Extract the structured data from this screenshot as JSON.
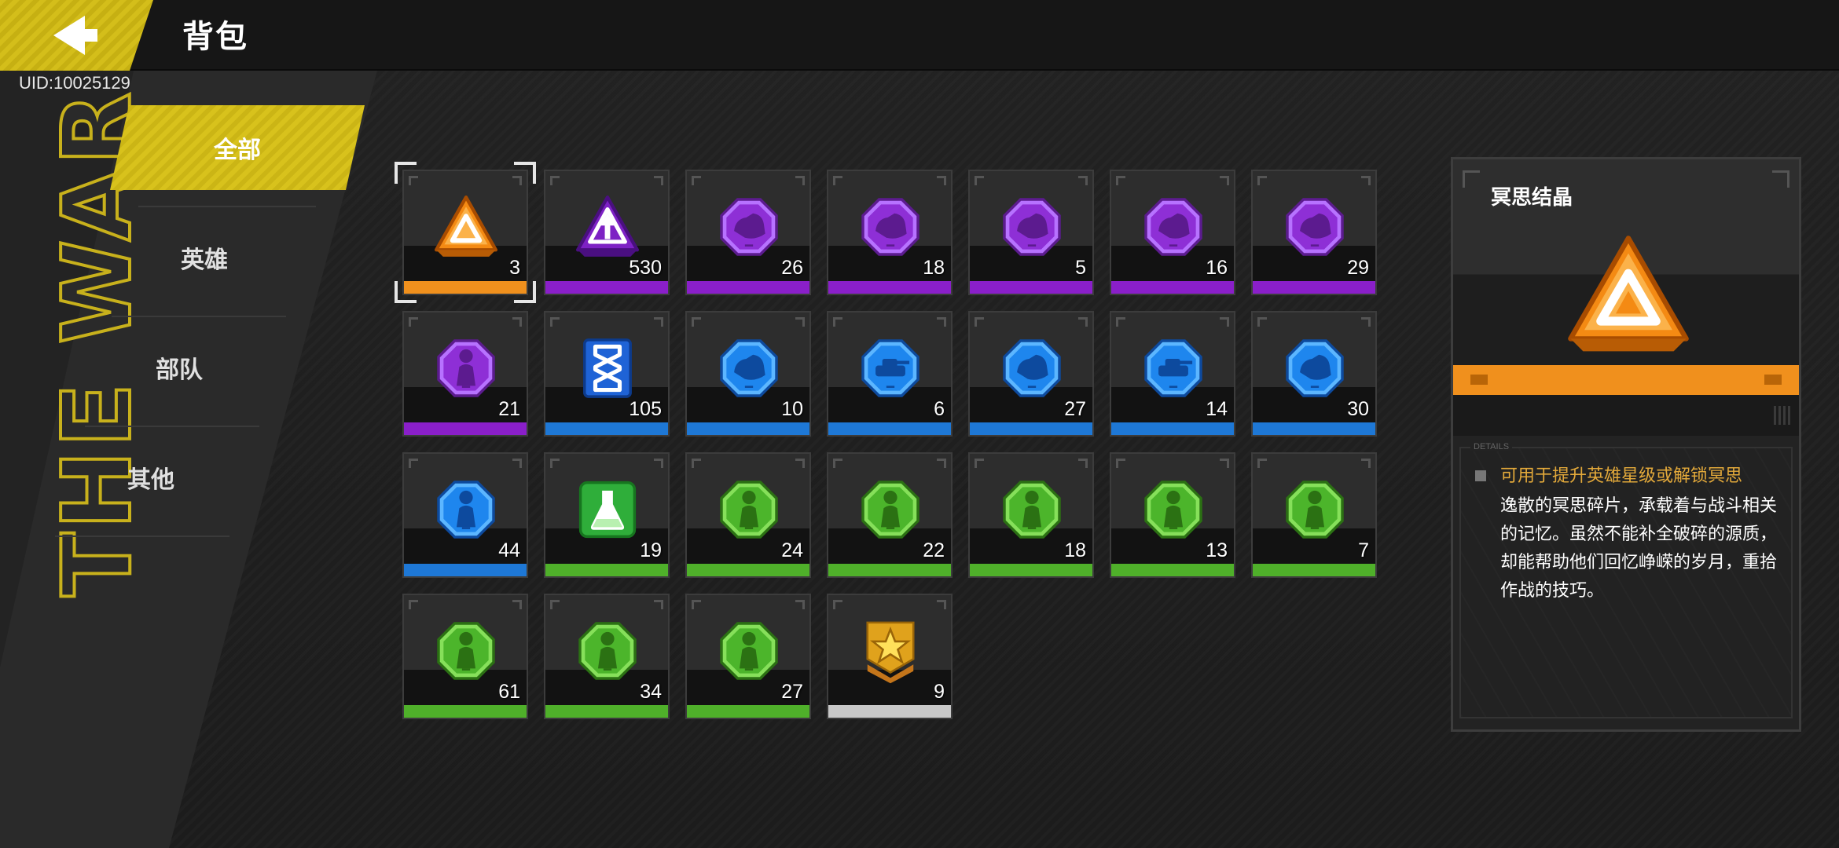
{
  "header": {
    "title": "背包",
    "uid": "UID:10025129",
    "back_icon": "back-arrow-icon"
  },
  "background_text": "THE WAR",
  "colors": {
    "accent_yellow": "#d8c21c",
    "rarity_orange": "#f0901d",
    "rarity_purple": "#8a1fc9",
    "rarity_blue": "#1e78d6",
    "rarity_green": "#4fb02a",
    "rarity_white": "#c8c8c8",
    "description_highlight": "#e3a93a"
  },
  "categories": [
    {
      "label": "全部",
      "active": true
    },
    {
      "label": "英雄",
      "active": false
    },
    {
      "label": "部队",
      "active": false
    },
    {
      "label": "其他",
      "active": false
    }
  ],
  "items": [
    {
      "count": "3",
      "rarity": "orange",
      "icon": "orange-triangle-crystal-icon",
      "selected": true
    },
    {
      "count": "530",
      "rarity": "purple",
      "icon": "purple-triangle-upgrade-icon"
    },
    {
      "count": "26",
      "rarity": "purple",
      "icon": "purple-unit-badge-icon"
    },
    {
      "count": "18",
      "rarity": "purple",
      "icon": "purple-unit-badge-icon"
    },
    {
      "count": "5",
      "rarity": "purple",
      "icon": "purple-unit-badge-icon"
    },
    {
      "count": "16",
      "rarity": "purple",
      "icon": "purple-unit-badge-icon"
    },
    {
      "count": "29",
      "rarity": "purple",
      "icon": "purple-unit-badge-icon"
    },
    {
      "count": "21",
      "rarity": "purple",
      "icon": "purple-hero-badge-icon"
    },
    {
      "count": "105",
      "rarity": "blue",
      "icon": "blue-dna-helix-icon"
    },
    {
      "count": "10",
      "rarity": "blue",
      "icon": "blue-unit-badge-icon"
    },
    {
      "count": "6",
      "rarity": "blue",
      "icon": "blue-tank-badge-icon"
    },
    {
      "count": "27",
      "rarity": "blue",
      "icon": "blue-unit-badge-icon"
    },
    {
      "count": "14",
      "rarity": "blue",
      "icon": "blue-tank-badge-icon"
    },
    {
      "count": "30",
      "rarity": "blue",
      "icon": "blue-unit-badge-icon"
    },
    {
      "count": "44",
      "rarity": "blue",
      "icon": "blue-hero-badge-icon"
    },
    {
      "count": "19",
      "rarity": "green",
      "icon": "green-flask-icon"
    },
    {
      "count": "24",
      "rarity": "green",
      "icon": "green-hero-badge-icon"
    },
    {
      "count": "22",
      "rarity": "green",
      "icon": "green-hero-badge-icon"
    },
    {
      "count": "18",
      "rarity": "green",
      "icon": "green-hero-badge-icon"
    },
    {
      "count": "13",
      "rarity": "green",
      "icon": "green-hero-badge-icon"
    },
    {
      "count": "7",
      "rarity": "green",
      "icon": "green-hero-badge-icon"
    },
    {
      "count": "61",
      "rarity": "green",
      "icon": "green-hero-badge-icon"
    },
    {
      "count": "34",
      "rarity": "green",
      "icon": "green-hero-badge-icon"
    },
    {
      "count": "27",
      "rarity": "green",
      "icon": "green-hero-badge-icon"
    },
    {
      "count": "9",
      "rarity": "white",
      "icon": "gold-star-rank-icon"
    }
  ],
  "detail": {
    "name": "冥思结晶",
    "icon": "orange-triangle-crystal-icon",
    "rarity": "orange",
    "section_tag": "DETAILS",
    "headline": "可用于提升英雄星级或解锁冥思",
    "body": "逸散的冥思碎片，承载着与战斗相关的记忆。虽然不能补全破碎的源质，却能帮助他们回忆峥嵘的岁月，重拾作战的技巧。"
  }
}
